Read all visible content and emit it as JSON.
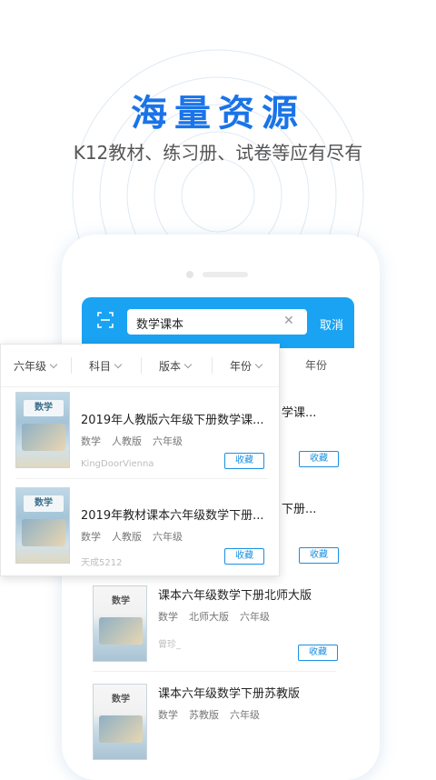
{
  "hero": {
    "title": "海量资源",
    "subtitle": "K12教材、练习册、试卷等应有尽有"
  },
  "search": {
    "value": "数学课本",
    "cancel_label": "取消"
  },
  "filters": [
    {
      "label": "六年级"
    },
    {
      "label": "科目"
    },
    {
      "label": "版本"
    },
    {
      "label": "年份"
    }
  ],
  "results": [
    {
      "title": "2019年人教版六年级下册数学课...",
      "tags": [
        "数学",
        "人教版",
        "六年级"
      ],
      "source": "KingDoorVienna",
      "fav_label": "收藏",
      "cover_text": "数学"
    },
    {
      "title": "2019年教材课本六年级数学下册...",
      "tags": [
        "数学",
        "人教版",
        "六年级"
      ],
      "source": "天成5212",
      "fav_label": "收藏",
      "cover_text": "数学"
    }
  ],
  "background_results": [
    {
      "title": "课本六年级数学下册北师大版",
      "tags": [
        "数学",
        "北师大版",
        "六年级"
      ],
      "source": "曾珍_",
      "fav_label": "收藏",
      "cover_text": "数学"
    },
    {
      "title": "课本六年级数学下册苏教版",
      "tags": [
        "数学",
        "苏教版",
        "六年级"
      ],
      "cover_text": "数学"
    }
  ],
  "behind": {
    "filter_label": "年份",
    "title_tail_1": "学课...",
    "title_tail_2": "下册...",
    "fav_label": "收藏"
  },
  "colors": {
    "accent": "#1aa3f2",
    "title": "#1a74e8"
  }
}
